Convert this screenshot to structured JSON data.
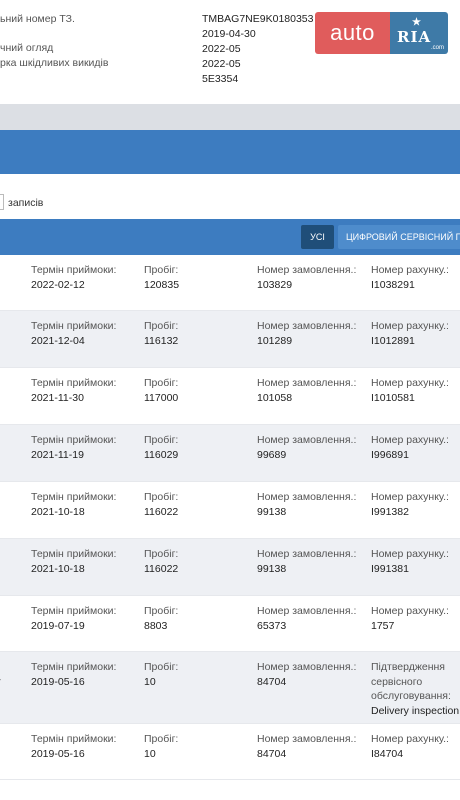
{
  "vehicle": {
    "labels": [
      "ьний номер ТЗ.",
      "чний огляд",
      "рка шкідливих викидів"
    ],
    "values": [
      "TMBAG7NE9K0180353",
      "2019-04-30",
      "2022-05",
      "2022-05",
      "5E3354"
    ]
  },
  "logo": {
    "auto": "auto",
    "ria": "RIA",
    "com": ".com"
  },
  "entries": {
    "label": "записів"
  },
  "tabs": {
    "all": "УСІ",
    "digital": "ЦИФРОВИЙ СЕРВІСНИЙ ПЛАН"
  },
  "labels": {
    "date": "Термін приймоки:",
    "mileage": "Пробіг:",
    "order": "Номер замовлення.:",
    "invoice": "Номер рахунку.:",
    "confirmation": "Підтвердження сервісного обслуговування:"
  },
  "records": [
    {
      "date": "2022-02-12",
      "mileage": "120835",
      "order": "103829",
      "invoice": "I1038291"
    },
    {
      "date": "2021-12-04",
      "mileage": "116132",
      "order": "101289",
      "invoice": "I1012891"
    },
    {
      "date": "2021-11-30",
      "mileage": "117000",
      "order": "101058",
      "invoice": "I1010581"
    },
    {
      "date": "2021-11-19",
      "mileage": "116029",
      "order": "99689",
      "invoice": "I996891"
    },
    {
      "date": "2021-10-18",
      "mileage": "116022",
      "order": "99138",
      "invoice": "I991382"
    },
    {
      "date": "2021-10-18",
      "mileage": "116022",
      "order": "99138",
      "invoice": "I991381"
    },
    {
      "date": "2019-07-19",
      "mileage": "8803",
      "order": "65373",
      "invoice": "1757"
    },
    {
      "date": "2019-05-16",
      "mileage": "10",
      "order": "84704",
      "confirmation": "Delivery inspection"
    },
    {
      "date": "2019-05-16",
      "mileage": "10",
      "order": "84704",
      "invoice": "I84704"
    }
  ]
}
